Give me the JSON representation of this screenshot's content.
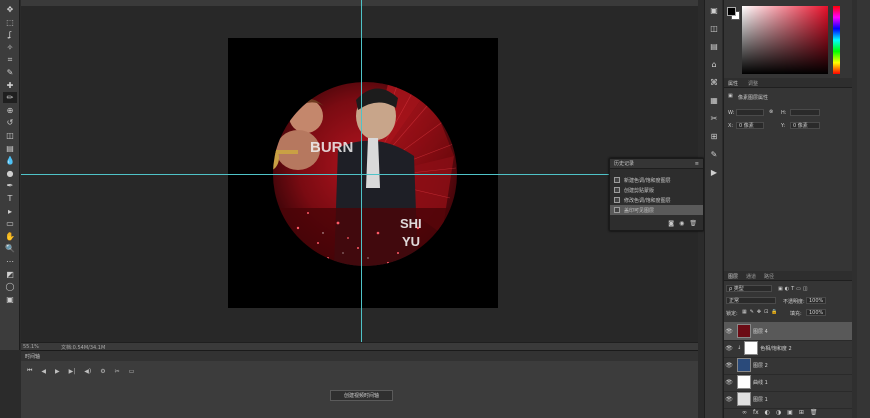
{
  "toolbar": {
    "tools": [
      "move",
      "marquee",
      "lasso",
      "magic-wand",
      "crop",
      "eyedropper",
      "healing",
      "brush",
      "stamp",
      "history-brush",
      "eraser",
      "gradient",
      "blur",
      "dodge",
      "pen",
      "type",
      "path-select",
      "shape",
      "hand",
      "zoom",
      "more",
      "fg-bg",
      "quickmask",
      "screen-mode"
    ],
    "glyphs": [
      "✥",
      "⬚",
      "ʆ",
      "✧",
      "⌗",
      "✎",
      "✚",
      "✏",
      "⊕",
      "↺",
      "◫",
      "▤",
      "💧",
      "●",
      "✒",
      "T",
      "▸",
      "▭",
      "✋",
      "🔍",
      "⋯",
      "◩",
      "◯",
      "▣"
    ]
  },
  "status": {
    "zoom": "55.1%",
    "doc": "文档:0.54M/34.1M"
  },
  "history": {
    "title": "历史记录",
    "items": [
      "新建色调/饱和度图层",
      "创建剪贴蒙版",
      "修改色调/饱和度图层",
      "盖印可见图层"
    ],
    "selected_index": 3
  },
  "timeline": {
    "title": "时间轴",
    "controls": [
      "⏮",
      "◀",
      "▶",
      "▶|",
      "◀)",
      "⚙",
      "✂",
      "▭"
    ],
    "create_button": "创建视频时间轴"
  },
  "panels": {
    "color_tab_icons": [
      "◩"
    ],
    "properties_tabs": [
      "属性",
      "调整"
    ],
    "properties_header": "像素图层属性",
    "w_label": "W:",
    "h_label": "H:",
    "x_label": "X:",
    "y_label": "Y:",
    "x_value": "0 像素",
    "y_value": "0 像素",
    "link_icon": "link-icon",
    "layers_tabs": [
      "图层",
      "通道",
      "路径"
    ],
    "filter_kind": "ρ 类型",
    "blend_mode": "正常",
    "opacity_label": "不透明度:",
    "opacity": "100%",
    "lock_label": "锁定:",
    "fill_label": "填充:",
    "fill": "100%",
    "layers": [
      {
        "name": "图层 4",
        "selected": true,
        "thumb": "#6b0b14",
        "clip": false
      },
      {
        "name": "色相/饱和度 2",
        "selected": false,
        "thumb": "#ffffff",
        "clip": true
      },
      {
        "name": "图层 2",
        "selected": false,
        "thumb": "#2a4a7a",
        "clip": false
      },
      {
        "name": "曲线 1",
        "selected": false,
        "thumb": "#ffffff",
        "clip": false
      },
      {
        "name": "图层 1",
        "selected": false,
        "thumb": "#e0e0e0",
        "clip": false
      }
    ],
    "layer_footer_icons": [
      "∞",
      "fx",
      "◐",
      "◑",
      "▣",
      "⊞",
      "🗑"
    ]
  },
  "canvas_art": {
    "text_lines": [
      "BURN",
      "SHI",
      "YU"
    ],
    "circle_color": "#8a0f16",
    "background": "#000000"
  },
  "midcol": {
    "glyphs": [
      "▣",
      "◫",
      "▤",
      "⌂",
      "⌘",
      "▦",
      "✂",
      "⊞",
      "✎",
      "▶"
    ]
  }
}
